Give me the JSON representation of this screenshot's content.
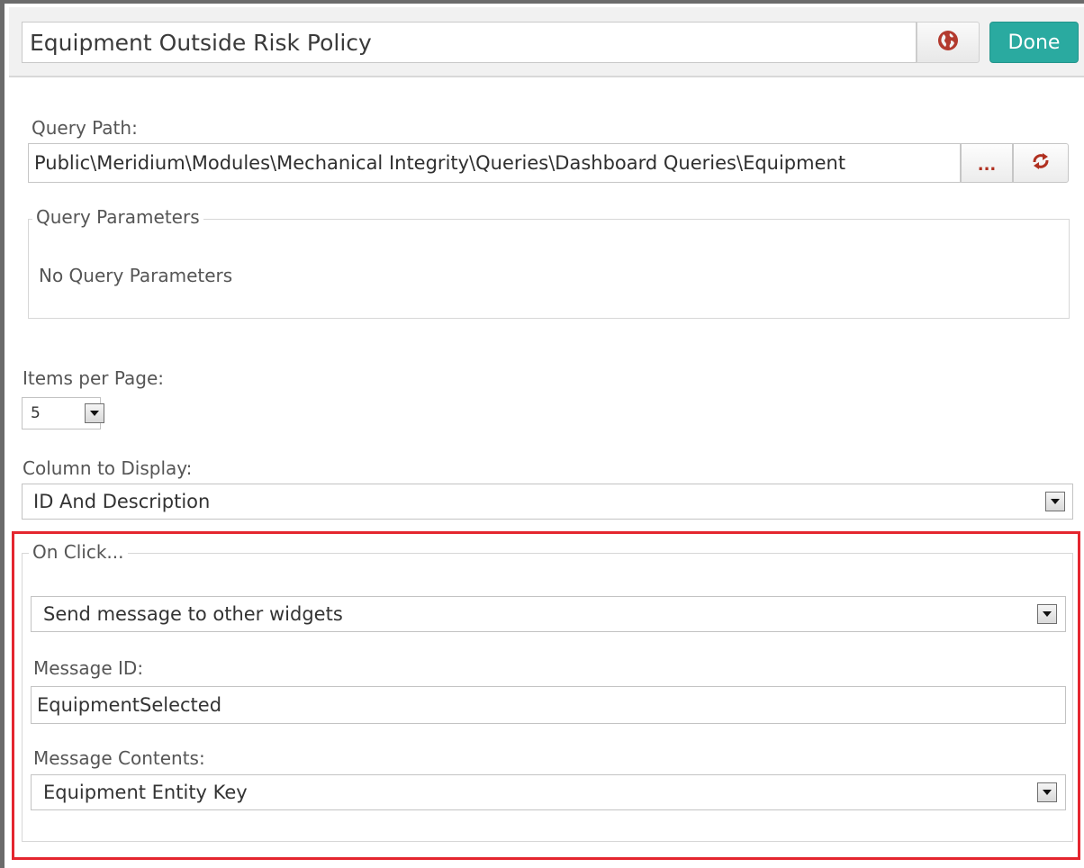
{
  "header": {
    "title_value": "Equipment Outside Risk Policy",
    "globe_icon": "globe-icon",
    "done_label": "Done"
  },
  "query": {
    "path_label": "Query Path:",
    "path_value": "Public\\Meridium\\Modules\\Mechanical Integrity\\Queries\\Dashboard Queries\\Equipment",
    "browse_label": "...",
    "refresh_icon": "refresh-icon",
    "parameters_legend": "Query Parameters",
    "parameters_empty": "No Query Parameters"
  },
  "paging": {
    "items_label": "Items per Page:",
    "items_value": "5"
  },
  "column": {
    "label": "Column to Display:",
    "value": "ID And Description"
  },
  "on_click": {
    "legend": "On Click...",
    "action_value": "Send message to other widgets",
    "message_id_label": "Message ID:",
    "message_id_value": "EquipmentSelected",
    "contents_label": "Message Contents:",
    "contents_value": "Equipment Entity Key"
  },
  "colors": {
    "done_button": "#2aaaa0",
    "highlight_border": "#e4262f",
    "icon_red": "#b03020"
  }
}
